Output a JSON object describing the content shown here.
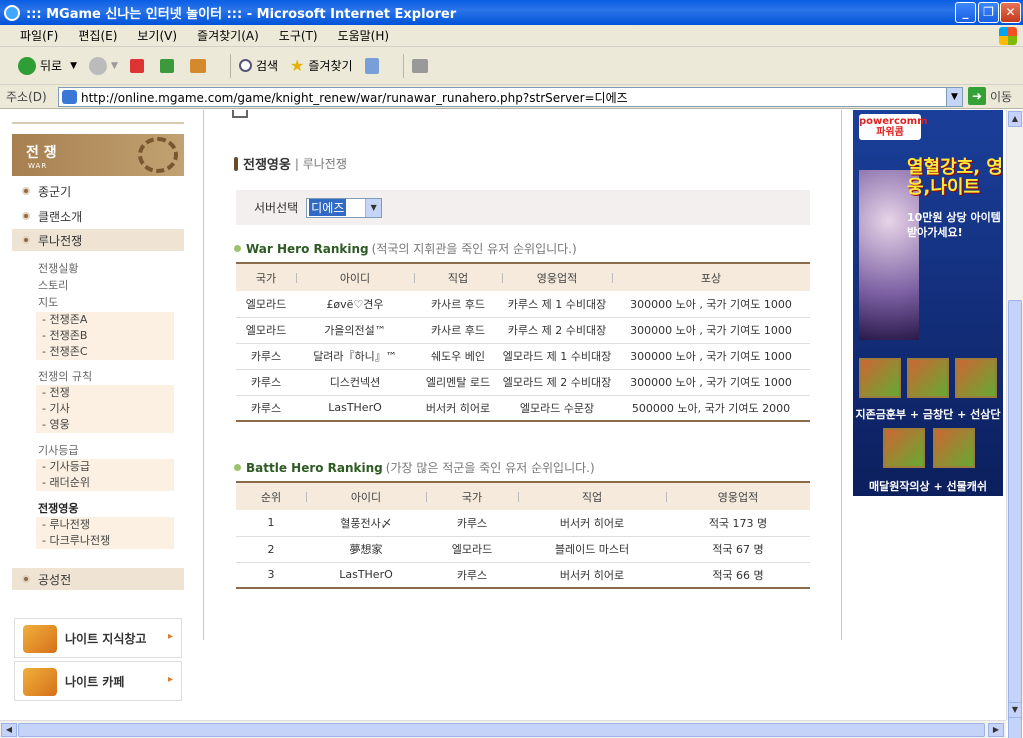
{
  "window": {
    "title": "::: MGame 신나는 인터넷 놀이터 ::: - Microsoft Internet Explorer"
  },
  "menu": [
    "파일(F)",
    "편집(E)",
    "보기(V)",
    "즐겨찾기(A)",
    "도구(T)",
    "도움말(H)"
  ],
  "toolbar": {
    "back": "뒤로",
    "search": "검색",
    "favorites": "즐겨찾기"
  },
  "address": {
    "label": "주소(D)",
    "url": "http://online.mgame.com/game/knight_renew/war/runawar_runahero.php?strServer=디에즈",
    "go": "이동"
  },
  "sidebar": {
    "header": "전 쟁",
    "header_sub": "WAR",
    "items": [
      "종군기",
      "클랜소개",
      "루나전쟁",
      "공성전"
    ],
    "sub": {
      "a": "전쟁실황",
      "b": "스토리",
      "c": "지도",
      "map": [
        "- 전쟁존A",
        "- 전쟁존B",
        "- 전쟁존C"
      ],
      "rules": "전쟁의 규칙",
      "rules_list": [
        "- 전쟁",
        "- 기사",
        "- 영웅"
      ],
      "rank": "기사등급",
      "rank_list": [
        "- 기사등급",
        "- 래더순위"
      ],
      "hero": "전쟁영웅",
      "hero_list": [
        "- 루나전쟁",
        "- 다크루나전쟁"
      ]
    },
    "links": [
      "나이트 지식창고",
      "나이트 카페"
    ]
  },
  "main": {
    "title": "전쟁영웅",
    "title_sub": "| 루나전쟁",
    "server_label": "서버선택",
    "server_value": "디에즈",
    "war": {
      "title": "War Hero Ranking",
      "note": "(적국의 지휘관을 죽인 유저 순위입니다.)",
      "headers": [
        "국가",
        "아이디",
        "직업",
        "영웅업적",
        "포상"
      ],
      "rows": [
        [
          "엘모라드",
          "£øvё♡견우",
          "카사르 후드",
          "카루스 제 1 수비대장",
          "300000 노아 , 국가 기여도 1000"
        ],
        [
          "엘모라드",
          "가을의전설™",
          "카사르 후드",
          "카루스 제 2 수비대장",
          "300000 노아 , 국가 기여도 1000"
        ],
        [
          "카루스",
          "달려라『하니』™",
          "쉐도우 베인",
          "엘모라드 제 1 수비대장",
          "300000 노아 , 국가 기여도 1000"
        ],
        [
          "카루스",
          "디스컨넥션",
          "엘리멘탈 로드",
          "엘모라드 제 2 수비대장",
          "300000 노아 , 국가 기여도 1000"
        ],
        [
          "카루스",
          "LasTHerO",
          "버서커 히어로",
          "엘모라드 수문장",
          "500000 노아, 국가 기여도 2000"
        ]
      ]
    },
    "battle": {
      "title": "Battle Hero Ranking",
      "note": "(가장 많은 적군을 죽인 유저 순위입니다.)",
      "headers": [
        "순위",
        "아이디",
        "국가",
        "직업",
        "영웅업적"
      ],
      "rows": [
        [
          "1",
          "혈풍전사〆",
          "카루스",
          "버서커 히어로",
          "적국 173 명"
        ],
        [
          "2",
          "夢想家",
          "엘모라드",
          "블레이드 마스터",
          "적국 67 명"
        ],
        [
          "3",
          "LasTHerO",
          "카루스",
          "버서커 히어로",
          "적국 66 명"
        ]
      ]
    }
  },
  "ad": {
    "brand": "powercomm 파워콤",
    "line1": "열혈강호, 영웅,나이트",
    "line2": "10만원 상당 아이템 받아가세요!",
    "cap1": "지존금훈부 + 금창단 + 선삼단",
    "cap2": "매달원작의상 + 선물캐쉬"
  }
}
